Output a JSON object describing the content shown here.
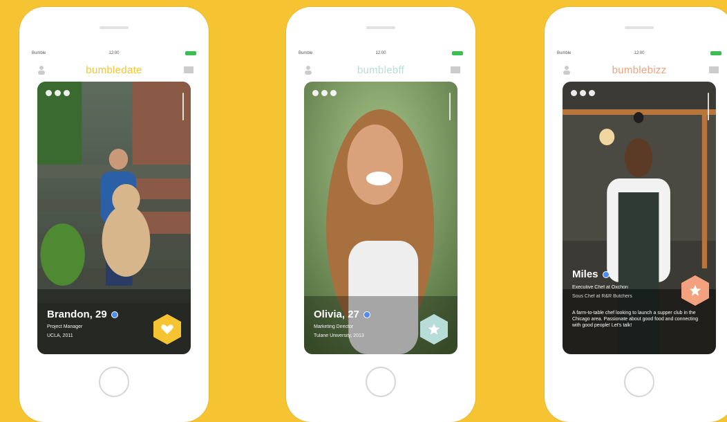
{
  "phones": [
    {
      "status": {
        "carrier": "Bumble",
        "time": "12:00"
      },
      "brand": {
        "main": "bumble",
        "sub": "date",
        "color": "#f6c332"
      },
      "profile": {
        "name": "Brandon, 29",
        "line1": "Project Manager",
        "line2": "UCLA, 2011",
        "action_icon": "heart-icon",
        "action_color": "#f6c332"
      }
    },
    {
      "status": {
        "carrier": "Bumble",
        "time": "12:00"
      },
      "brand": {
        "main": "bumble",
        "sub": "bff",
        "color": "#b8ddd9"
      },
      "profile": {
        "name": "Olivia, 27",
        "line1": "Marketing Director",
        "line2": "Tulane University, 2013",
        "action_icon": "star-icon",
        "action_color": "#b8ddd9"
      }
    },
    {
      "status": {
        "carrier": "Bumble",
        "time": "12:00"
      },
      "brand": {
        "main": "bumble",
        "sub": "bizz",
        "color": "#f3a17e"
      },
      "profile": {
        "name": "Miles",
        "line1": "Executive Chef at Oxchon",
        "line2": "Sous Chef at R&R Butchers",
        "bio": "A farm-to-table chef looking to launch a supper club in the Chicago area. Passionate about good food and connecting with good people! Let's talk!",
        "action_icon": "star-icon",
        "action_color": "#f3a17e"
      }
    }
  ]
}
